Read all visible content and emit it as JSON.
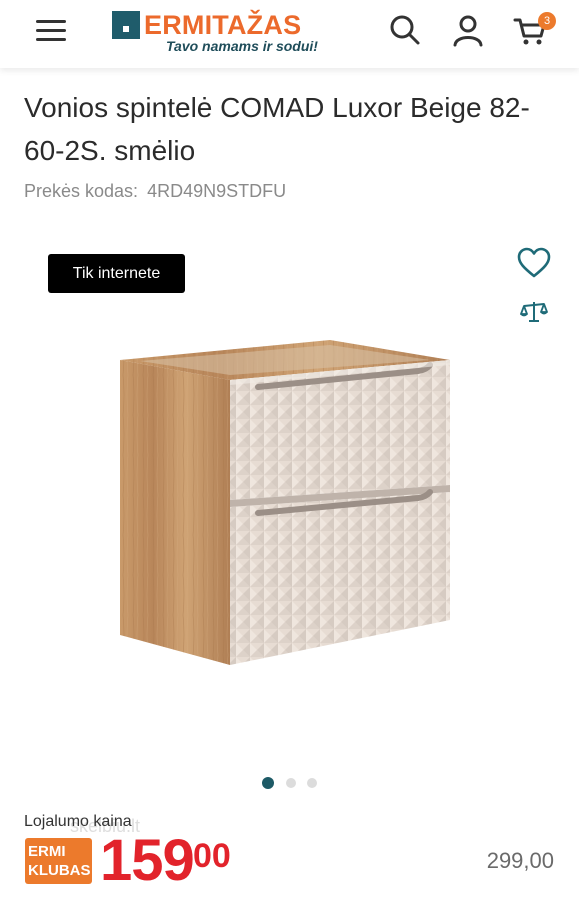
{
  "header": {
    "logo_text": "ERMITAŽAS",
    "logo_slogan": "Tavo namams ir sodui!",
    "cart_count": "3",
    "icons": [
      "menu-icon",
      "search-icon",
      "user-icon",
      "cart-icon"
    ]
  },
  "product": {
    "title": "Vonios spintelė COMAD Luxor Beige 82-60-2S. smėlio",
    "sku_label": "Prekės kodas:",
    "sku_value": "4RD49N9STDFU",
    "badge": "Tik internete",
    "gallery": {
      "total_images": 3,
      "active_index": 0
    }
  },
  "price": {
    "loyalty_label": "Lojalumo kaina",
    "club_badge_line1": "ERMI",
    "club_badge_line2": "KLUBAS",
    "main_integer": "159",
    "main_decimal": "00",
    "old_price": "299,00"
  },
  "watermark": "skelbiu.lt",
  "colors": {
    "brand_orange": "#ec6a2c",
    "brand_teal": "#1f5c6b",
    "price_red": "#e2232b",
    "badge_black": "#000000"
  }
}
